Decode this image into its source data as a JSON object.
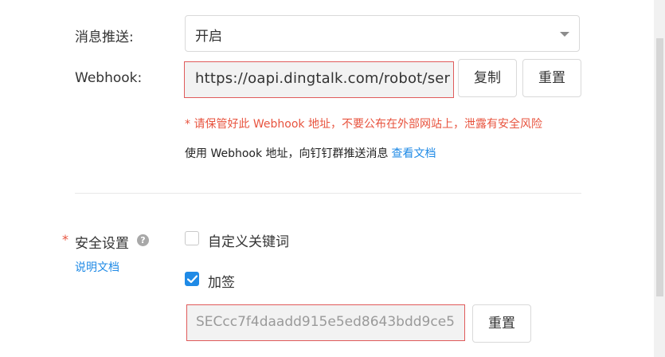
{
  "push": {
    "label": "消息推送:",
    "value": "开启"
  },
  "webhook": {
    "label": "Webhook:",
    "url": "https://oapi.dingtalk.com/robot/ser",
    "copy_label": "复制",
    "reset_label": "重置",
    "warning": "* 请保管好此 Webhook 地址，不要公布在外部网站上，泄露有安全风险",
    "info": "使用 Webhook 地址，向钉钉群推送消息",
    "info_link": "查看文档"
  },
  "security": {
    "required_mark": "*",
    "label": "安全设置",
    "help_icon": "?",
    "doc_link": "说明文档",
    "options": [
      {
        "label": "自定义关键词",
        "checked": false
      },
      {
        "label": "加签",
        "checked": true
      }
    ],
    "secret_value": "SECcc7f4daadd915e5ed8643bdd9ce5",
    "reset_label": "重置"
  },
  "colors": {
    "accent": "#1f8ae6",
    "warning": "#e8543f",
    "highlight_border": "#e05b5b"
  }
}
